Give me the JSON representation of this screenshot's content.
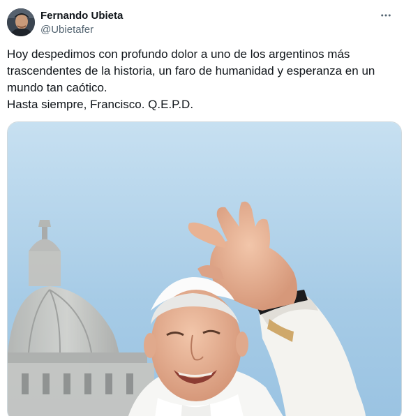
{
  "author": {
    "display_name": "Fernando Ubieta",
    "handle": "@Ubietafer",
    "avatar_icon": "user-avatar-photo"
  },
  "more_icon": "more-horizontal-icon",
  "tweet": {
    "lines": [
      "Hoy despedimos con profundo dolor a uno de los argentinos más trascendentes de la historia, un faro de humanidad y esperanza en un mundo tan caótico.",
      "Hasta siempre, Francisco. Q.E.P.D."
    ]
  },
  "media": {
    "type": "photo",
    "icon": "photo-pope-waving"
  },
  "colors": {
    "text": "#0f1419",
    "secondary": "#536471",
    "border": "#cfd9de",
    "sky": "#a9cde6"
  }
}
